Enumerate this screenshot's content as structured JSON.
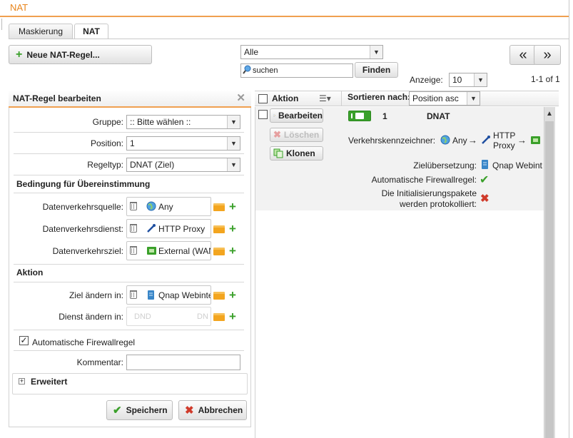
{
  "page_title": "NAT",
  "tabs": [
    {
      "label": "Maskierung",
      "active": false
    },
    {
      "label": "NAT",
      "active": true
    }
  ],
  "toolbar": {
    "new_rule_label": "Neue NAT-Regel...",
    "filter_value": "Alle",
    "search_placeholder": "suchen",
    "find_label": "Finden",
    "prev_label": "«",
    "next_label": "»",
    "display_label": "Anzeige:",
    "display_value": "10",
    "page_info": "1-1 of 1"
  },
  "edit_panel": {
    "title": "NAT-Regel bearbeiten",
    "group_label": "Gruppe:",
    "group_value": ":: Bitte wählen ::",
    "position_label": "Position:",
    "position_value": "1",
    "ruletype_label": "Regeltyp:",
    "ruletype_value": "DNAT (Ziel)",
    "condition_heading": "Bedingung für Übereinstimmung",
    "source_label": "Datenverkehrsquelle:",
    "source_value": "Any",
    "service_label": "Datenverkehrsdienst:",
    "service_value": "HTTP Proxy",
    "dest_label": "Datenverkehrsziel:",
    "dest_value": "External (WAN)",
    "action_heading": "Aktion",
    "change_target_label": "Ziel ändern in:",
    "change_target_value": "Qnap Webinterface",
    "change_service_label": "Dienst ändern in:",
    "change_service_value": "DND",
    "change_service_value2": "DN",
    "auto_fw_label": "Automatische Firewallregel",
    "auto_fw_checked": true,
    "comment_label": "Kommentar:",
    "comment_value": "",
    "advanced_label": "Erweitert",
    "save_label": "Speichern",
    "cancel_label": "Abbrechen"
  },
  "grid": {
    "action_header": "Aktion",
    "sort_label": "Sortieren nach:",
    "sort_value": "Position asc",
    "row": {
      "edit_label": "Bearbeiten",
      "delete_label": "Löschen",
      "clone_label": "Klonen",
      "number": "1",
      "type": "DNAT",
      "traffic_label": "Verkehrskennzeichner:",
      "traffic_source": "Any",
      "traffic_arrow": "→",
      "traffic_service_line1": "HTTP",
      "traffic_service_line2": "Proxy",
      "translation_label": "Zielübersetzung:",
      "translation_value": "Qnap Webint",
      "auto_fw_label": "Automatische Firewallregel:",
      "log_label_line1": "Die Initialisierungspakete",
      "log_label_line2": "werden protokolliert:"
    }
  },
  "colors": {
    "accent": "#e8841a",
    "green": "#3aa02a",
    "red": "#d03a2a"
  }
}
